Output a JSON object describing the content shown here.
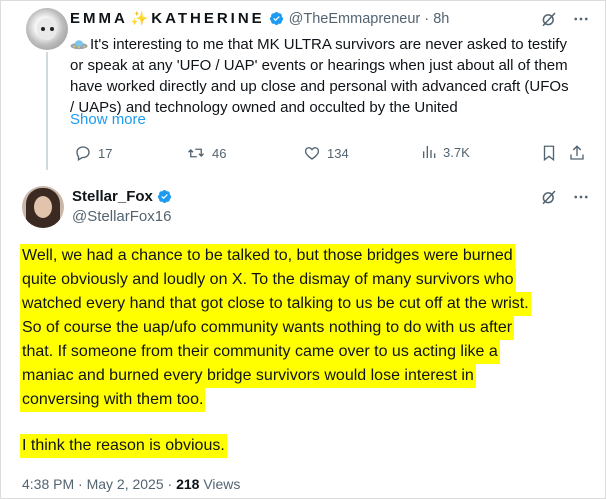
{
  "parent": {
    "display_name": "EMMA",
    "display_name_suffix": "KATHERINE",
    "sparkle_glyph": "✨",
    "handle": "@TheEmmapreneur",
    "time": "8h",
    "text_lines": [
      "It's interesting to me that MK ULTRA survivors are never asked to testify",
      "or speak at any 'UFO / UAP' events or hearings when just about all of them",
      "have worked directly and up close and personal with advanced craft (UFOs",
      "/ UAPs) and technology owned and occulted by the United"
    ],
    "show_more": "Show more",
    "stats": {
      "replies": "17",
      "reposts": "46",
      "likes": "134",
      "views": "3.7K"
    }
  },
  "reply": {
    "display_name": "Stellar_Fox",
    "handle": "@StellarFox16",
    "highlighted_lines": [
      "Well, we had a chance to be talked to, but those bridges were burned",
      "quite obviously and loudly on X. To the dismay of many survivors who",
      "watched every hand that got close to talking to us be cut off at the wrist.",
      "So of course the uap/ufo community wants nothing to do with us after",
      "that. If someone from their community came over to us acting like a",
      "maniac and burned every bridge survivors would lose interest in",
      "conversing with them too."
    ],
    "closing_line": "I think the reason is obvious.",
    "timestamp": "4:38 PM · May 2, 2025 · ",
    "views_count": "218",
    "views_label": " Views"
  },
  "colors": {
    "highlight": "#ffff00",
    "link": "#1d9bf0",
    "verified": "#1d9bf0",
    "muted": "#536471"
  },
  "icons": [
    "ufo-emoji-icon",
    "verified-badge-icon",
    "grok-icon",
    "more-icon",
    "reply-icon",
    "repost-icon",
    "like-icon",
    "views-icon",
    "bookmark-icon",
    "share-icon"
  ]
}
